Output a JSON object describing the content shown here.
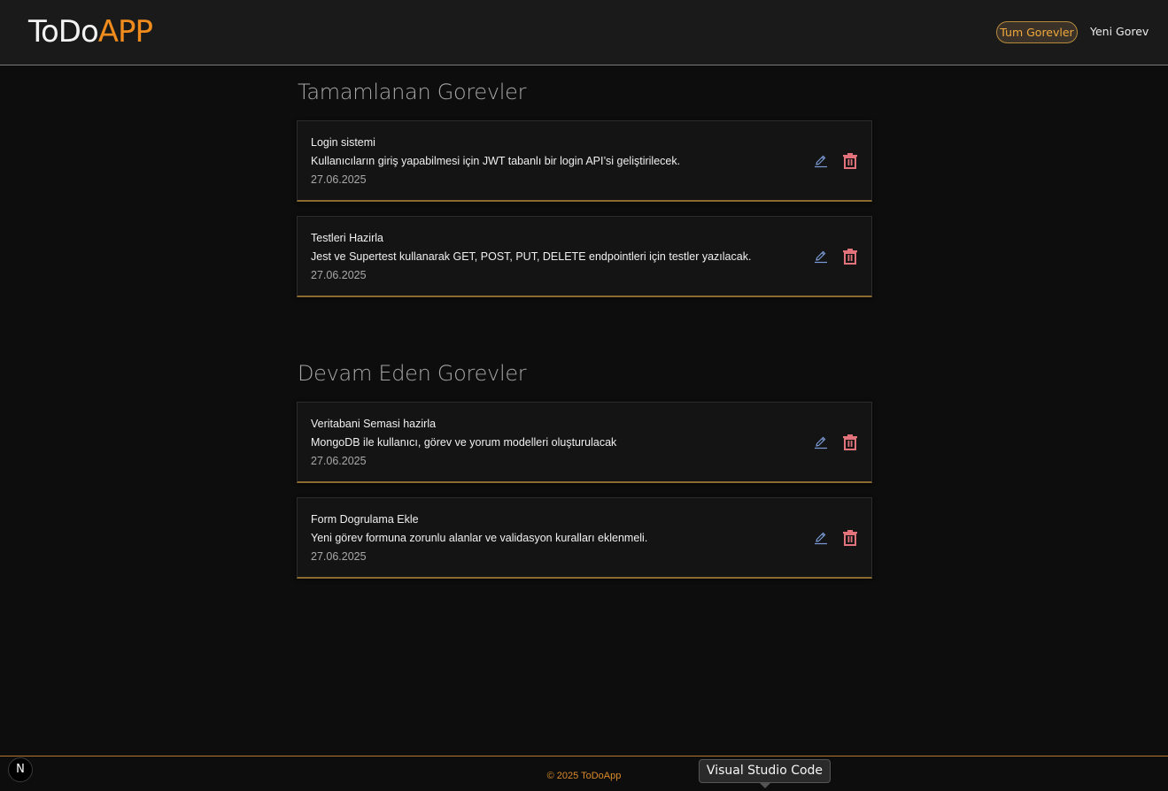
{
  "header": {
    "logo_part1": "ToDo",
    "logo_part2": "APP",
    "nav": [
      {
        "label": "Tum Gorevler",
        "active": true
      },
      {
        "label": "Yeni Gorev",
        "active": false
      }
    ]
  },
  "sections": [
    {
      "title": "Tamamlanan Gorevler",
      "tasks": [
        {
          "title": "Login sistemi",
          "description": "Kullanıcıların giriş yapabilmesi için JWT tabanlı bir login API’si geliştirilecek.",
          "date": "27.06.2025"
        },
        {
          "title": "Testleri Hazirla",
          "description": "Jest ve Supertest kullanarak GET, POST, PUT, DELETE endpointleri için testler yazılacak.",
          "date": "27.06.2025"
        }
      ]
    },
    {
      "title": "Devam Eden Gorevler",
      "tasks": [
        {
          "title": "Veritabani Semasi hazirla",
          "description": "MongoDB ile kullanıcı, görev ve yorum modelleri oluşturulacak",
          "date": "27.06.2025"
        },
        {
          "title": "Form Dogrulama Ekle",
          "description": "Yeni görev formuna zorunlu alanlar ve validasyon kuralları eklenmeli.",
          "date": "27.06.2025"
        }
      ]
    }
  ],
  "icons": {
    "edit": "pencil-icon",
    "delete": "trash-icon"
  },
  "colors": {
    "accent": "#f08c1d",
    "edit_icon": "#7b9bd6",
    "delete_icon": "#e2737a",
    "card_border": "#8a6d2e"
  },
  "footer": {
    "copyright": "© 2025 ToDoApp"
  },
  "badge": {
    "label": "N"
  },
  "tooltip": {
    "text": "Visual Studio Code"
  }
}
